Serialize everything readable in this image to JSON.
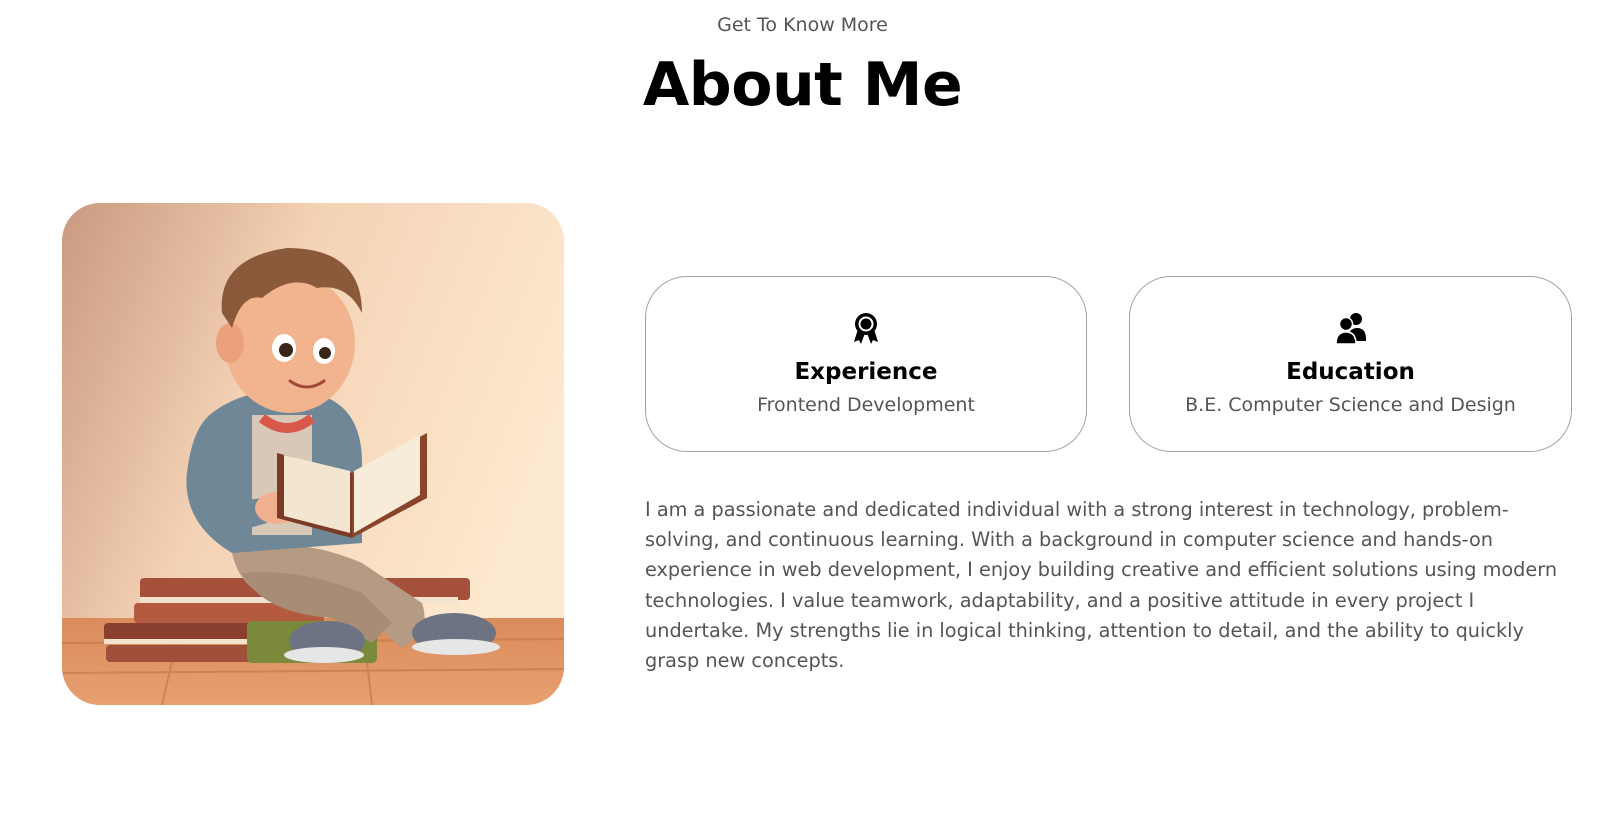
{
  "header": {
    "subtitle": "Get To Know More",
    "title": "About Me"
  },
  "profile_image": {
    "description_icon": "boy-reading-book-illustration"
  },
  "cards": [
    {
      "icon": "award-medal-icon",
      "title": "Experience",
      "detail": "Frontend Development"
    },
    {
      "icon": "users-group-icon",
      "title": "Education",
      "detail": "B.E. Computer Science and Design"
    }
  ],
  "bio": "I am a passionate and dedicated individual with a strong interest in technology, problem-solving, and continuous learning. With a background in computer science and hands-on experience in web development, I enjoy building creative and efficient solutions using modern technologies. I value teamwork, adaptability, and a positive attitude in every project I undertake. My strengths lie in logical thinking, attention to detail, and the ability to quickly grasp new concepts.",
  "colors": {
    "heading": "#000000",
    "text": "#555555",
    "card_border": "#a3a3a3",
    "background": "#ffffff"
  }
}
